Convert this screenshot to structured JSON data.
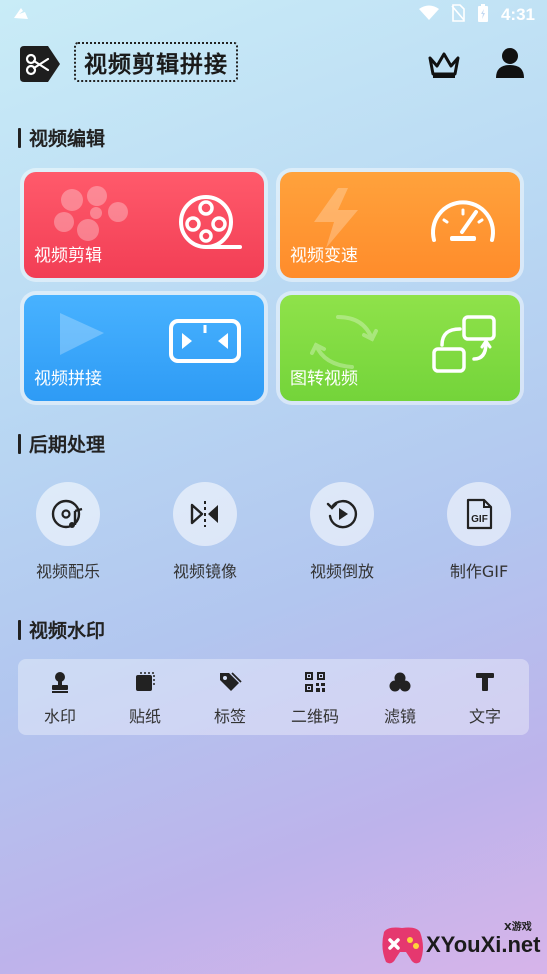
{
  "status_bar": {
    "time": "4:31"
  },
  "header": {
    "app_title": "视频剪辑拼接"
  },
  "sections": {
    "edit": "视频编辑",
    "post": "后期处理",
    "watermark": "视频水印"
  },
  "cards": [
    {
      "label": "视频剪辑",
      "color": "#f23e55"
    },
    {
      "label": "视频变速",
      "color": "#ff8c2b"
    },
    {
      "label": "视频拼接",
      "color": "#2e9bf5"
    },
    {
      "label": "图转视频",
      "color": "#74d43a"
    }
  ],
  "post_tools": [
    {
      "label": "视频配乐",
      "icon": "music-disc-icon"
    },
    {
      "label": "视频镜像",
      "icon": "mirror-icon"
    },
    {
      "label": "视频倒放",
      "icon": "rewind-play-icon"
    },
    {
      "label": "制作GIF",
      "icon": "gif-file-icon"
    }
  ],
  "watermark_tools": [
    {
      "label": "水印",
      "icon": "stamp-icon"
    },
    {
      "label": "贴纸",
      "icon": "sticker-icon"
    },
    {
      "label": "标签",
      "icon": "tag-icon"
    },
    {
      "label": "二维码",
      "icon": "qrcode-icon"
    },
    {
      "label": "滤镜",
      "icon": "filter-icon"
    },
    {
      "label": "文字",
      "icon": "text-icon"
    }
  ],
  "brand": {
    "text": "XYouXi.net",
    "sub": "X游戏"
  }
}
